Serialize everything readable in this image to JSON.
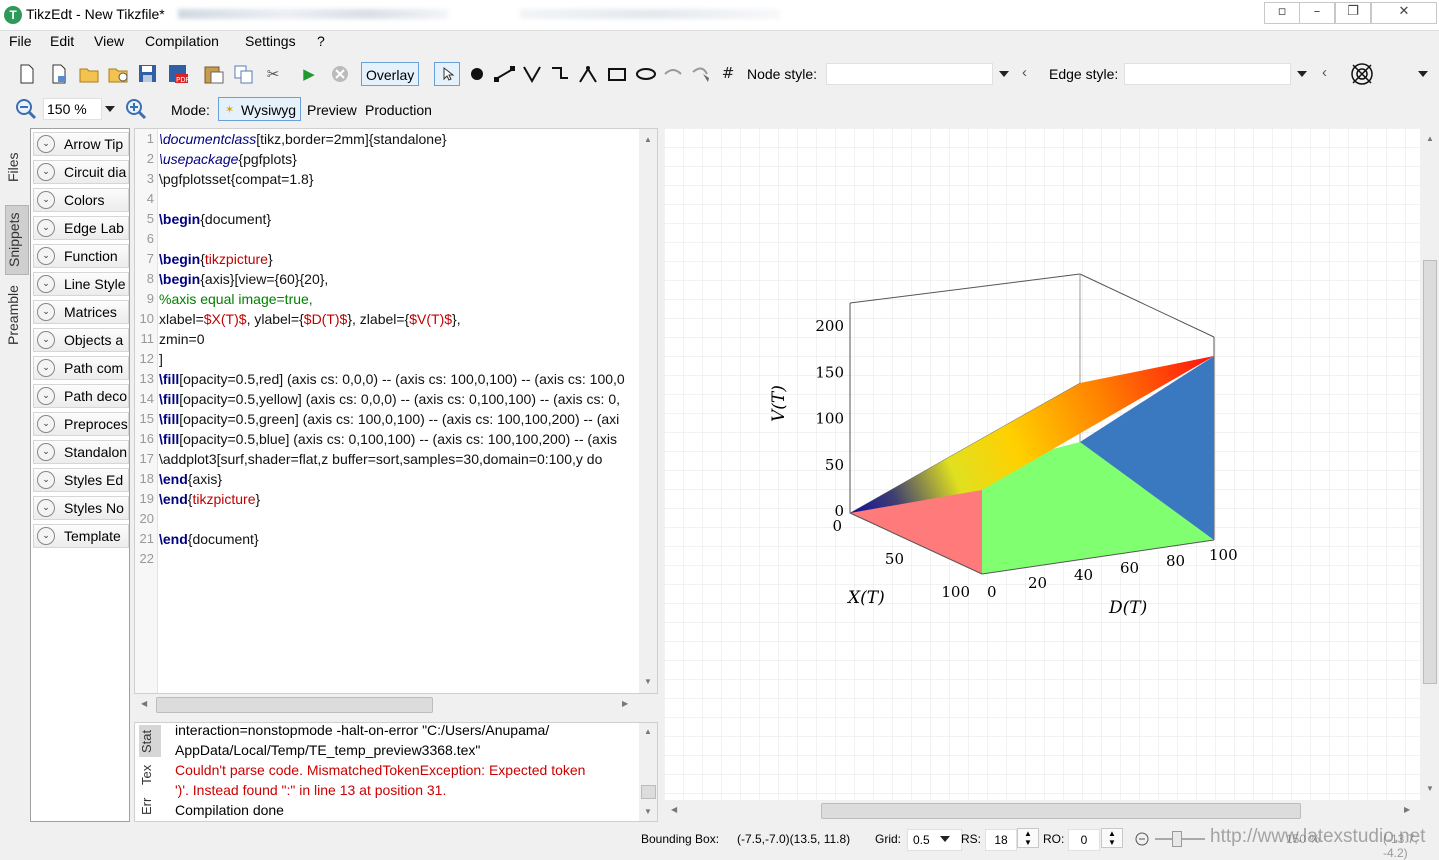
{
  "window": {
    "app_icon_letter": "T",
    "title": "TikzEdt - New Tikzfile*",
    "minimize_glyph": "–",
    "maximize_glyph": "❐",
    "close_glyph": "✕",
    "extra_glyph": "▫"
  },
  "menu": [
    "File",
    "Edit",
    "View",
    "Compilation",
    "Settings",
    "?"
  ],
  "toolbar1": {
    "overlay_label": "Overlay",
    "node_style_label": "Node style:",
    "node_style_value": "",
    "edge_style_label": "Edge style:",
    "edge_style_value": ""
  },
  "toolbar2": {
    "zoom_value": "150 %",
    "mode_label": "Mode:",
    "modes": [
      "Wysiwyg",
      "Preview",
      "Production"
    ]
  },
  "side_tabs": [
    "Files",
    "Snippets",
    "Preamble"
  ],
  "snippets": [
    "Arrow Tip",
    "Circuit dia",
    "Colors",
    "Edge Lab",
    "Function",
    "Line Style",
    "Matrices",
    "Objects a",
    "Path com",
    "Path deco",
    "Preproces",
    "Standalon",
    "Styles Ed",
    "Styles No",
    "Template"
  ],
  "editor": {
    "lines": [
      {
        "n": "1",
        "segs": [
          {
            "c": "it",
            "t": "\\documentclass"
          },
          {
            "c": "",
            "t": "[tikz,border=2mm]{standalone}"
          }
        ]
      },
      {
        "n": "2",
        "segs": [
          {
            "c": "it",
            "t": "\\usepackage"
          },
          {
            "c": "",
            "t": "{pgfplots}"
          }
        ]
      },
      {
        "n": "3",
        "segs": [
          {
            "c": "",
            "t": "\\pgfplotsset{compat=1.8}"
          }
        ]
      },
      {
        "n": "4",
        "segs": []
      },
      {
        "n": "5",
        "segs": [
          {
            "c": "kw",
            "t": "\\begin"
          },
          {
            "c": "",
            "t": "{document}"
          }
        ]
      },
      {
        "n": "6",
        "segs": []
      },
      {
        "n": "7",
        "segs": [
          {
            "c": "kw",
            "t": "\\begin"
          },
          {
            "c": "",
            "t": "{"
          },
          {
            "c": "red",
            "t": "tikzpicture"
          },
          {
            "c": "",
            "t": "}"
          }
        ]
      },
      {
        "n": "8",
        "segs": [
          {
            "c": "kw",
            "t": "\\begin"
          },
          {
            "c": "",
            "t": "{axis}[view={60}{20},"
          }
        ]
      },
      {
        "n": "9",
        "segs": [
          {
            "c": "grn",
            "t": "%axis equal image=true,"
          }
        ]
      },
      {
        "n": "10",
        "segs": [
          {
            "c": "",
            "t": "xlabel="
          },
          {
            "c": "str",
            "t": "$X(T)$"
          },
          {
            "c": "",
            "t": ", ylabel={"
          },
          {
            "c": "str",
            "t": "$D(T)$"
          },
          {
            "c": "",
            "t": "}, zlabel={"
          },
          {
            "c": "str",
            "t": "$V(T)$"
          },
          {
            "c": "",
            "t": "},"
          }
        ]
      },
      {
        "n": "11",
        "segs": [
          {
            "c": "",
            "t": "zmin=0"
          }
        ]
      },
      {
        "n": "12",
        "segs": [
          {
            "c": "",
            "t": "]"
          }
        ]
      },
      {
        "n": "13",
        "segs": [
          {
            "c": "kw",
            "t": "\\fill"
          },
          {
            "c": "",
            "t": "[opacity=0.5,red] (axis cs: 0,0,0) -- (axis cs: 100,0,100) -- (axis cs: 100,0"
          }
        ]
      },
      {
        "n": "14",
        "segs": [
          {
            "c": "kw",
            "t": "\\fill"
          },
          {
            "c": "",
            "t": "[opacity=0.5,yellow] (axis cs: 0,0,0) -- (axis cs: 0,100,100) -- (axis cs: 0,"
          }
        ]
      },
      {
        "n": "15",
        "segs": [
          {
            "c": "kw",
            "t": "\\fill"
          },
          {
            "c": "",
            "t": "[opacity=0.5,green] (axis cs: 100,0,100) -- (axis cs: 100,100,200) -- (axi"
          }
        ]
      },
      {
        "n": "16",
        "segs": [
          {
            "c": "kw",
            "t": "\\fill"
          },
          {
            "c": "",
            "t": "[opacity=0.5,blue] (axis cs: 0,100,100) -- (axis cs: 100,100,200) -- (axis"
          }
        ]
      },
      {
        "n": "17",
        "segs": [
          {
            "c": "",
            "t": "\\addplot3[surf,shader=flat,z buffer=sort,samples=30,domain=0:100,y do"
          }
        ]
      },
      {
        "n": "18",
        "segs": [
          {
            "c": "kw",
            "t": "\\end"
          },
          {
            "c": "",
            "t": "{axis}"
          }
        ]
      },
      {
        "n": "19",
        "segs": [
          {
            "c": "kw",
            "t": "\\end"
          },
          {
            "c": "",
            "t": "{"
          },
          {
            "c": "red",
            "t": "tikzpicture"
          },
          {
            "c": "",
            "t": "}"
          }
        ]
      },
      {
        "n": "20",
        "segs": []
      },
      {
        "n": "21",
        "segs": [
          {
            "c": "kw",
            "t": "\\end"
          },
          {
            "c": "",
            "t": "{document}"
          }
        ]
      },
      {
        "n": "22",
        "segs": []
      }
    ]
  },
  "log": {
    "tabs": [
      "Stat",
      "Tex",
      "Err"
    ],
    "lines": [
      {
        "t": "interaction=nonstopmode -halt-on-error \"C:/Users/Anupama/",
        "err": false
      },
      {
        "t": "AppData/Local/Temp/TE_temp_preview3368.tex\"",
        "err": false
      },
      {
        "t": "Couldn't parse code. MismatchedTokenException: Expected token",
        "err": true
      },
      {
        "t": "')'. Instead found \":\" in line 13 at position 31.",
        "err": true
      },
      {
        "t": "Compilation done",
        "err": false
      }
    ]
  },
  "preview": {
    "zlabel": "V(T)",
    "xlabel": "X(T)",
    "ylabel": "D(T)",
    "z_ticks": [
      "0",
      "50",
      "100",
      "150",
      "200"
    ],
    "x_ticks": [
      "0",
      "50",
      "100"
    ],
    "y_ticks": [
      "0",
      "20",
      "40",
      "60",
      "80",
      "100"
    ]
  },
  "status": {
    "bbox_label": "Bounding Box:",
    "bbox_value": "(-7.5,-7.0)(13.5, 11.8)",
    "grid_label": "Grid:",
    "grid_value": "0.5",
    "rs_label": "RS:",
    "rs_value": "18",
    "ro_label": "RO:",
    "ro_value": "0",
    "watermark": "http://www.latexstudio.net",
    "zoom_faded": "150 %",
    "coords_faded": "(-13.7, -4.2)"
  },
  "colors": {
    "accent": "#6a9fd8",
    "error_text": "#cc0000",
    "keyword": "#00007f",
    "comment": "#008000"
  }
}
